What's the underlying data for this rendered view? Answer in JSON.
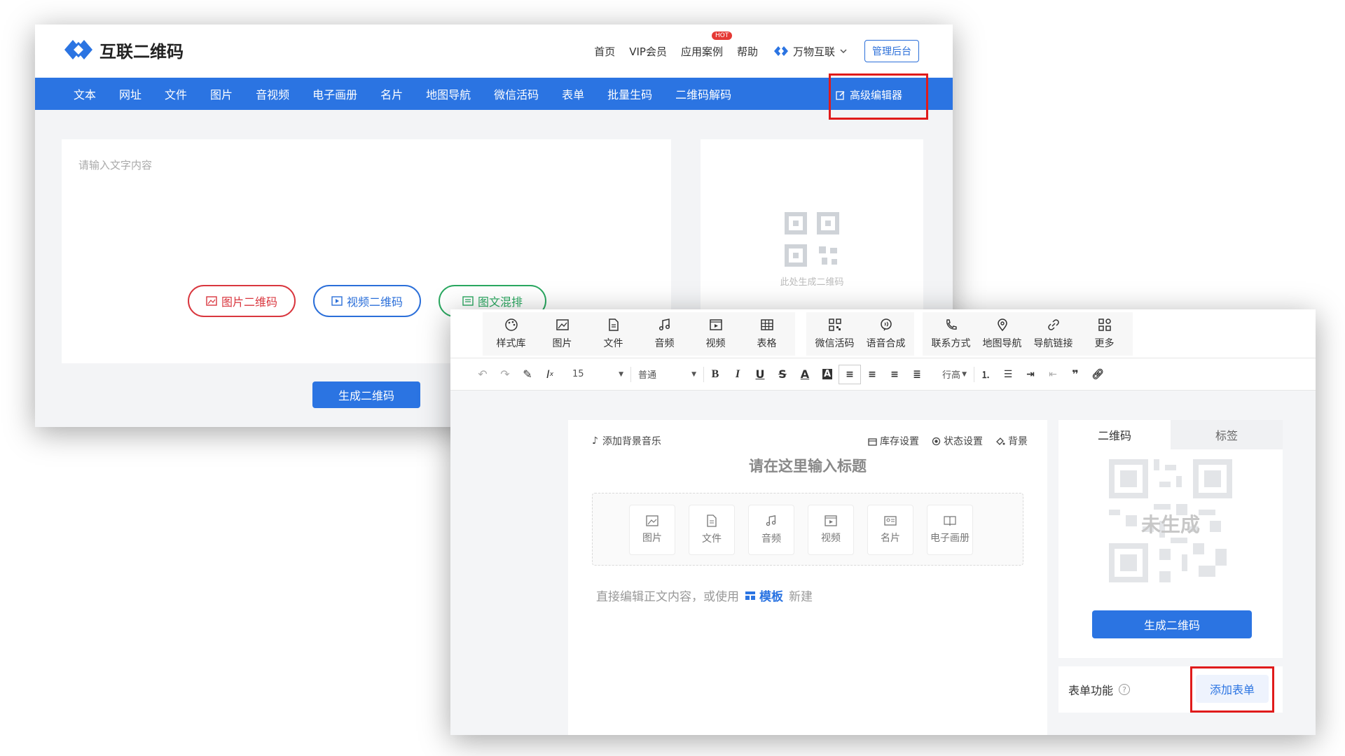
{
  "shot1": {
    "brand": {
      "title": "互联二维码",
      "icon": "diamond-logo-icon"
    },
    "topnav": [
      {
        "label": "首页"
      },
      {
        "label": "VIP会员"
      },
      {
        "label": "应用案例",
        "badge": "HOT"
      },
      {
        "label": "帮助"
      }
    ],
    "brand_menu": {
      "label": "万物互联",
      "icon": "chevron-down-icon"
    },
    "admin_label": "管理后台",
    "nav": [
      "文本",
      "网址",
      "文件",
      "图片",
      "音视频",
      "电子画册",
      "名片",
      "地图导航",
      "微信活码",
      "表单",
      "批量生码",
      "二维码解码"
    ],
    "advanced_editor": {
      "label": "高级编辑器",
      "icon": "edit-icon"
    },
    "text_placeholder": "请输入文字内容",
    "pills": [
      {
        "label": "图片二维码",
        "icon": "image-icon",
        "color": "#d9363e"
      },
      {
        "label": "视频二维码",
        "icon": "video-icon",
        "color": "#2b6fd9"
      },
      {
        "label": "图文混排",
        "icon": "layout-icon",
        "color": "#2aa860"
      }
    ],
    "qr_caption": "此处生成二维码",
    "generate_label": "生成二维码"
  },
  "shot2": {
    "tool_groups": [
      [
        {
          "label": "样式库",
          "icon": "palette-icon"
        },
        {
          "label": "图片",
          "icon": "image-icon"
        },
        {
          "label": "文件",
          "icon": "file-icon"
        },
        {
          "label": "音频",
          "icon": "music-icon"
        },
        {
          "label": "视频",
          "icon": "video-icon"
        },
        {
          "label": "表格",
          "icon": "table-icon"
        }
      ],
      [
        {
          "label": "微信活码",
          "icon": "qr-small-icon"
        },
        {
          "label": "语音合成",
          "icon": "voice-icon"
        }
      ],
      [
        {
          "label": "联系方式",
          "icon": "phone-icon"
        },
        {
          "label": "地图导航",
          "icon": "map-pin-icon"
        },
        {
          "label": "导航链接",
          "icon": "link-icon"
        },
        {
          "label": "更多",
          "icon": "grid-icon"
        }
      ]
    ],
    "format": {
      "font_size": "15",
      "paragraph": "普通",
      "line_height": "行高"
    },
    "editor": {
      "bg_music": "添加背景音乐",
      "stock": "库存设置",
      "status": "状态设置",
      "background": "背景",
      "title_placeholder": "请在这里输入标题",
      "inserts": [
        {
          "label": "图片",
          "icon": "image-icon"
        },
        {
          "label": "文件",
          "icon": "file-icon"
        },
        {
          "label": "音频",
          "icon": "music-icon"
        },
        {
          "label": "视频",
          "icon": "video-icon"
        },
        {
          "label": "名片",
          "icon": "card-icon"
        },
        {
          "label": "电子画册",
          "icon": "book-icon"
        }
      ],
      "hint_before": "直接编辑正文内容，或使用",
      "template": "模板",
      "hint_after": "新建"
    },
    "side": {
      "tabs": [
        "二维码",
        "标签"
      ],
      "not_generated": "未生成",
      "generate_label": "生成二维码"
    },
    "form_function": "表单功能",
    "add_form": "添加表单"
  },
  "colors": {
    "primary": "#2b74e2",
    "highlight": "#e01b1b"
  }
}
